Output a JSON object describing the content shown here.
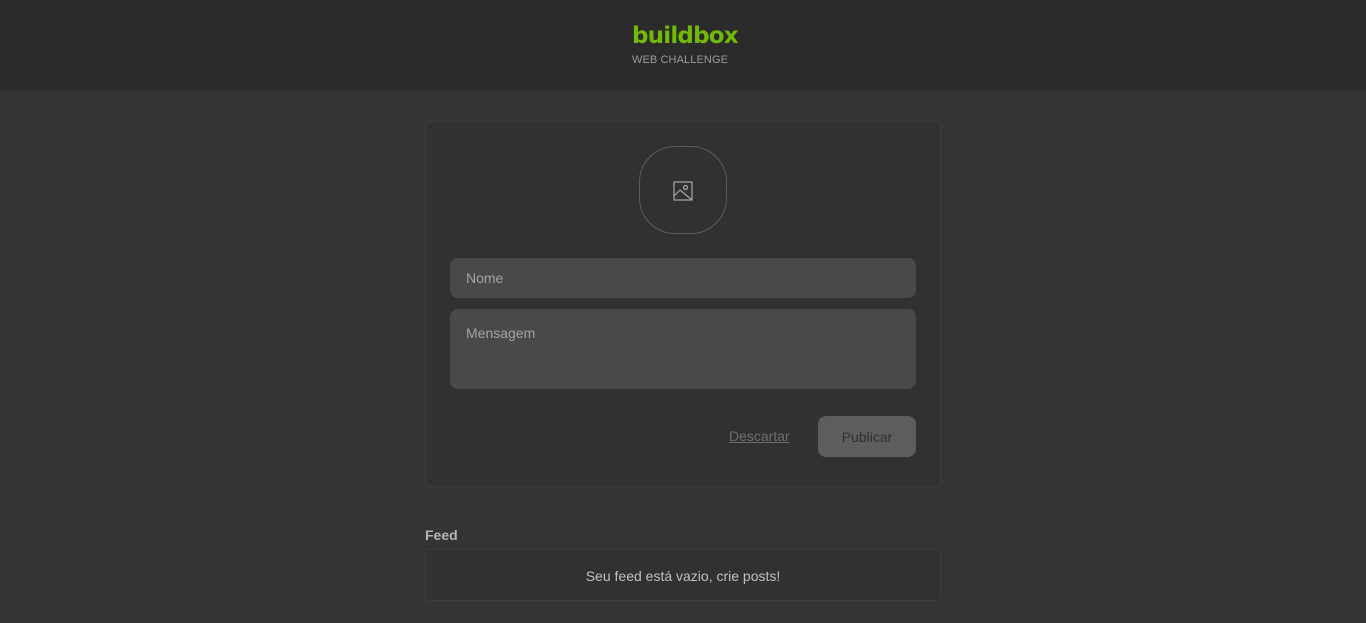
{
  "header": {
    "logo": "buildbox",
    "subtitle": "WEB CHALLENGE"
  },
  "composer": {
    "image_icon": "image-icon",
    "name_placeholder": "Nome",
    "message_placeholder": "Mensagem",
    "discard_label": "Descartar",
    "publish_label": "Publicar"
  },
  "feed": {
    "title": "Feed",
    "empty_message": "Seu feed está vazio, crie posts!"
  },
  "colors": {
    "brand": "#71b807",
    "background": "#343434",
    "header_bg": "#2b2b2b",
    "card_bg": "#313131",
    "input_bg": "#494949",
    "button_disabled": "#5d5d5d"
  }
}
